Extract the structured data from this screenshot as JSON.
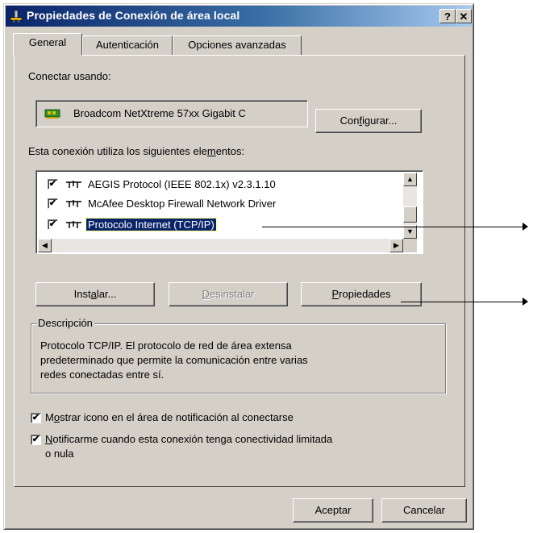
{
  "window": {
    "title": "Propiedades de Conexión de área local",
    "help_btn": "?",
    "close_btn": "✕"
  },
  "tabs": [
    {
      "label": "General",
      "active": true
    },
    {
      "label": "Autenticación",
      "active": false
    },
    {
      "label": "Opciones avanzadas",
      "active": false
    }
  ],
  "connect": {
    "label": "Conectar usando:",
    "device": "Broadcom NetXtreme 57xx Gigabit C",
    "configure_button": {
      "pre": "Con",
      "ul": "f",
      "post": "igurar..."
    }
  },
  "components": {
    "label": {
      "pre": "Esta conexión utiliza los siguientes ele",
      "ul": "m",
      "post": "entos:"
    },
    "items": [
      {
        "label": "AEGIS Protocol (IEEE 802.1x) v2.3.1.10",
        "checked": true,
        "selected": false
      },
      {
        "label": "McAfee Desktop Firewall Network Driver",
        "checked": true,
        "selected": false
      },
      {
        "label": "Protocolo Internet (TCP/IP)",
        "checked": true,
        "selected": true
      }
    ]
  },
  "buttons": {
    "install": {
      "pre": "Inst",
      "ul": "a",
      "post": "lar..."
    },
    "uninstall": {
      "pre": "",
      "ul": "D",
      "post": "esinstalar"
    },
    "properties": {
      "pre": "",
      "ul": "P",
      "post": "ropiedades"
    },
    "ok": "Aceptar",
    "cancel": "Cancelar"
  },
  "description": {
    "legend": "Descripción",
    "line1": "Protocolo TCP/IP. El protocolo de red de área extensa",
    "line2": "predeterminado que permite la comunicación entre varias",
    "line3": "redes conectadas entre sí."
  },
  "options": {
    "show_icon": {
      "pre": "M",
      "ul": "o",
      "post": "strar icono en el área de notificación al conectarse",
      "checked": true
    },
    "notify": {
      "pre": "",
      "ul": "N",
      "post": "otificarme cuando esta conexión tenga conectividad limitada",
      "line2": "o nula",
      "checked": true
    }
  },
  "check_glyph": "✔",
  "scroll_glyphs": {
    "up": "▲",
    "down": "▼",
    "left": "◀",
    "right": "▶"
  }
}
